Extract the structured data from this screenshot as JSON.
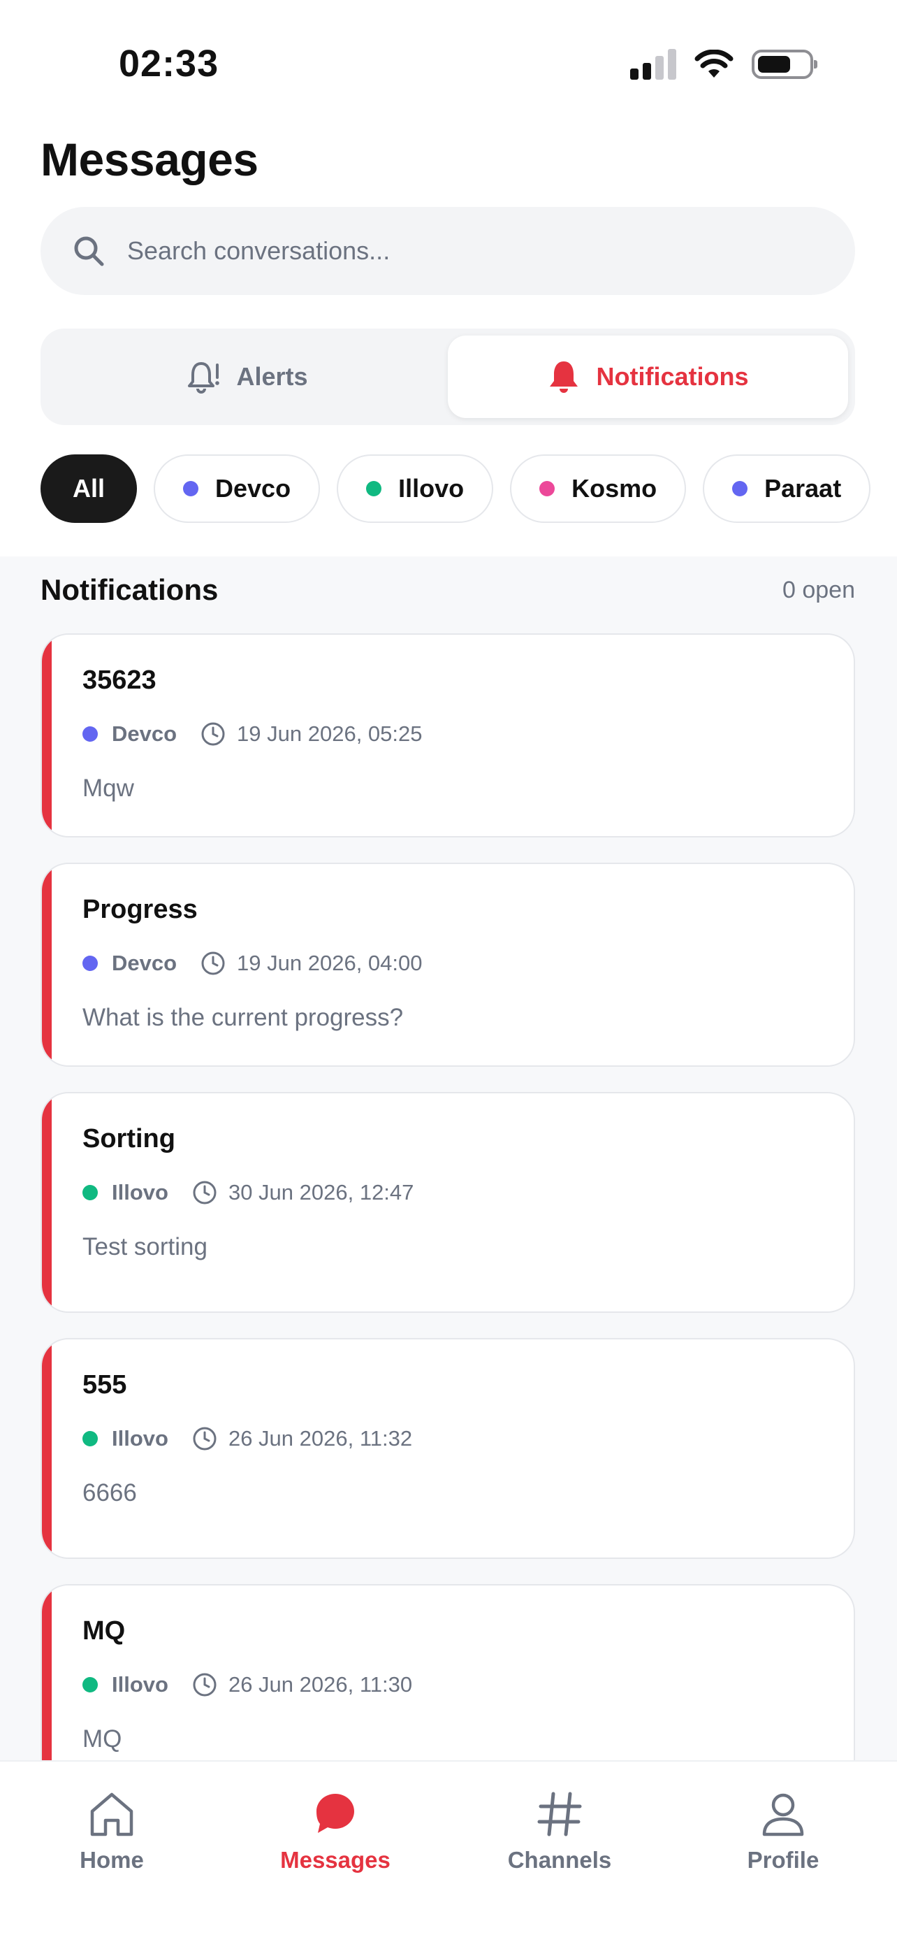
{
  "status_bar": {
    "time": "02:33"
  },
  "header": {
    "title": "Messages"
  },
  "search": {
    "placeholder": "Search conversations..."
  },
  "segments": [
    {
      "label": "Alerts",
      "icon": "bell-alert-outline-icon",
      "active": false
    },
    {
      "label": "Notifications",
      "icon": "bell-filled-icon",
      "active": true
    }
  ],
  "filters": [
    {
      "label": "All",
      "active": true
    },
    {
      "label": "Devco",
      "color": "#6366f1"
    },
    {
      "label": "Illovo",
      "color": "#10b981"
    },
    {
      "label": "Kosmo",
      "color": "#ec4899"
    },
    {
      "label": "Paraat",
      "color": "#6366f1"
    }
  ],
  "section": {
    "title": "Notifications",
    "count": "0 open"
  },
  "notifications": [
    {
      "title": "35623",
      "org": "Devco",
      "color": "#6366f1",
      "time": "19 Jun 2026, 05:25",
      "body": "Mqw"
    },
    {
      "title": "Progress",
      "org": "Devco",
      "color": "#6366f1",
      "time": "19 Jun 2026, 04:00",
      "body": "What is the current progress?"
    },
    {
      "title": "Sorting",
      "org": "Illovo",
      "color": "#10b981",
      "time": "30 Jun 2026, 12:47",
      "body": "Test sorting"
    },
    {
      "title": "555",
      "org": "Illovo",
      "color": "#10b981",
      "time": "26 Jun 2026, 11:32",
      "body": "6666"
    },
    {
      "title": "MQ",
      "org": "Illovo",
      "color": "#10b981",
      "time": "26 Jun 2026, 11:30",
      "body": "MQ"
    }
  ],
  "nav": [
    {
      "label": "Home",
      "icon": "home-icon"
    },
    {
      "label": "Messages",
      "icon": "chat-bubble-icon",
      "active": true
    },
    {
      "label": "Channels",
      "icon": "hash-icon"
    },
    {
      "label": "Profile",
      "icon": "user-icon"
    }
  ],
  "colors": {
    "accent": "#e53340",
    "muted": "#6b7280"
  }
}
